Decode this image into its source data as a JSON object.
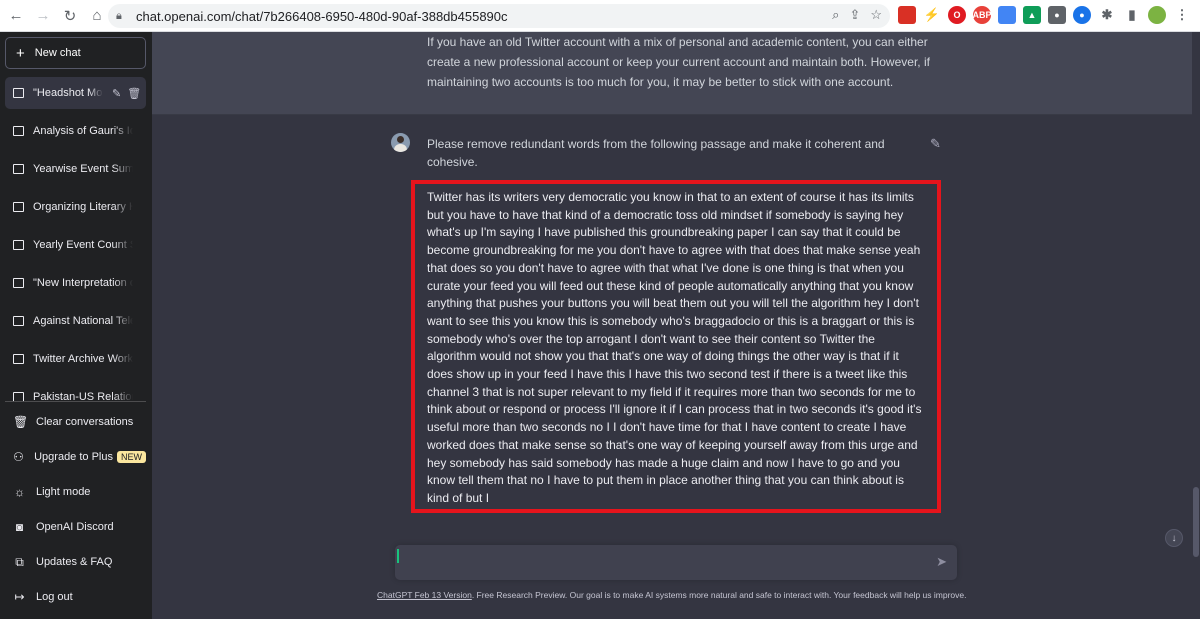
{
  "browser": {
    "url": "chat.openai.com/chat/7b266408-6950-480d-90af-388db455890c",
    "back_icon": "arrow-left-icon",
    "forward_icon": "arrow-right-icon",
    "reload_icon": "reload-icon",
    "home_icon": "home-icon",
    "extensions": [
      {
        "name": "bookmark-red",
        "color": "#d93025",
        "text": ""
      },
      {
        "name": "lightning",
        "color": "#202124",
        "text": "⚡"
      },
      {
        "name": "opera-red",
        "color": "#e01b22",
        "text": "O"
      },
      {
        "name": "adblock-plus",
        "color": "#e8413a",
        "text": "ABP"
      },
      {
        "name": "docs",
        "color": "#4285f4",
        "text": ""
      },
      {
        "name": "drive",
        "color": "#0f9d58",
        "text": "▲"
      },
      {
        "name": "screen-record",
        "color": "#5f6368",
        "text": "●"
      },
      {
        "name": "blue-circle",
        "color": "#1a73e8",
        "text": "●"
      },
      {
        "name": "puzzle",
        "color": "#5f6368",
        "text": "✱"
      },
      {
        "name": "sidepanel",
        "color": "#5f6368",
        "text": "▮"
      },
      {
        "name": "profile",
        "color": "#7cb342",
        "text": ""
      },
      {
        "name": "menu-kebab",
        "color": "#5f6368",
        "text": "⋮"
      }
    ]
  },
  "sidebar": {
    "new_chat": "New chat",
    "conversations": [
      {
        "label": "\"Headshot Mo",
        "active": true
      },
      {
        "label": "Analysis of Gauri's Ide",
        "active": false
      },
      {
        "label": "Yearwise Event Summ",
        "active": false
      },
      {
        "label": "Organizing Literary Hi",
        "active": false
      },
      {
        "label": "Yearly Event Count Su",
        "active": false
      },
      {
        "label": "\"New Interpretation of",
        "active": false
      },
      {
        "label": "Against National Telec",
        "active": false
      },
      {
        "label": "Twitter Archive Workfl",
        "active": false
      },
      {
        "label": "Pakistan-US Relations",
        "active": false
      }
    ],
    "menu": {
      "clear": "Clear conversations",
      "upgrade": "Upgrade to Plus",
      "upgrade_badge": "NEW",
      "light_mode": "Light mode",
      "discord": "OpenAI Discord",
      "updates": "Updates & FAQ",
      "logout": "Log out"
    }
  },
  "main": {
    "assistant_text": "If you have an old Twitter account with a mix of personal and academic content, you can either create a new professional account or keep your current account and maintain both. However, if maintaining two accounts is too much for you, it may be better to stick with one account.",
    "user_intro": "Please remove redundant words from the following passage and make it coherent and cohesive.",
    "user_passage": "Twitter has its writers very democratic you know in that to an extent of course it has its limits but you have to have that kind of a democratic toss old mindset if somebody is saying hey what's up I'm saying I have published this groundbreaking paper I can say that it could be become groundbreaking for me you don't have to agree with that does that make sense yeah that does so you don't have to agree with that what I've done is one thing is that when you curate your feed you will feed out these kind of people automatically anything that you know anything that pushes your buttons you will beat them out you will tell the algorithm hey I don't want to see this you know this is somebody who's braggadocio or this is a braggart or this is somebody who's over the top arrogant I don't want to see their content so Twitter the algorithm would not show you that that's one way of doing things the other way is that if it does show up in your feed I have this I have this two second test if there is a tweet like this channel 3 that is not super relevant to my field if it requires more than two seconds for me to think about or respond or process I'll ignore it if I can process that in two seconds it's good it's useful more than two seconds no I I don't have time for that I have content to create I have worked does that make sense so that's one way of keeping yourself away from this urge and hey somebody has said somebody has made a huge claim and now I have to go and you know tell them that no I have to put them in place another thing that you can think about is kind of but I",
    "input_placeholder": "",
    "footer_link": "ChatGPT Feb 13 Version",
    "footer_rest": ". Free Research Preview. Our goal is to make AI systems more natural and safe to interact with. Your feedback will help us improve."
  }
}
